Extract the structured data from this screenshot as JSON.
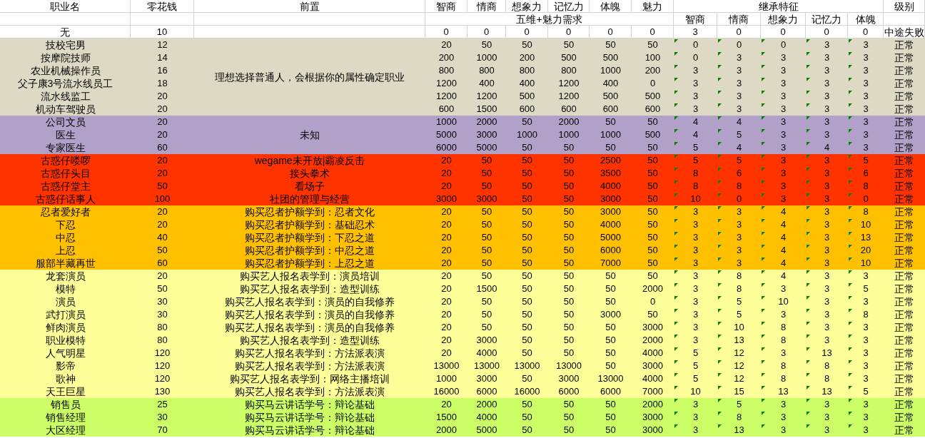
{
  "header": {
    "columns": [
      "职业名",
      "零花钱",
      "前置",
      "智商",
      "情商",
      "想象力",
      "记忆力",
      "体魄",
      "魅力"
    ],
    "inherit_title": "继承特征",
    "level_title": "级别"
  },
  "subheader": {
    "requirements_title": "五维+魅力需求",
    "inherit_columns": [
      "智商",
      "情商",
      "想象力",
      "记忆力",
      "体魄"
    ]
  },
  "base_row": {
    "name": "无",
    "money": "10",
    "requirements": [
      "0",
      "0",
      "0",
      "0",
      "0",
      "0"
    ],
    "inherit": [
      "3",
      "0",
      "0",
      "0",
      "0"
    ],
    "level": "中途失败"
  },
  "groups": [
    {
      "color": "#ddd9c4",
      "flagged": true,
      "prerequisite": "理想选择普通人，会根据你的属性确定职业",
      "rows": [
        {
          "name": "技校宅男",
          "money": "12",
          "requirements": [
            "20",
            "50",
            "50",
            "50",
            "50",
            "50"
          ],
          "inherit": [
            "0",
            "0",
            "0",
            "3",
            "3"
          ],
          "level": "正常"
        },
        {
          "name": "按摩院技师",
          "money": "14",
          "requirements": [
            "200",
            "1000",
            "200",
            "500",
            "500",
            "100"
          ],
          "inherit": [
            "0",
            "3",
            "3",
            "3",
            "3"
          ],
          "level": "正常"
        },
        {
          "name": "农业机械操作员",
          "money": "16",
          "requirements": [
            "800",
            "800",
            "800",
            "800",
            "1000",
            "200"
          ],
          "inherit": [
            "3",
            "3",
            "3",
            "3",
            "3"
          ],
          "level": "正常"
        },
        {
          "name": "父子康3号流水线员工",
          "money": "18",
          "requirements": [
            "1200",
            "400",
            "400",
            "1200",
            "400",
            "0"
          ],
          "inherit": [
            "3",
            "3",
            "3",
            "3",
            "3"
          ],
          "level": "正常"
        },
        {
          "name": "流水线监工",
          "money": "20",
          "requirements": [
            "1200",
            "1200",
            "500",
            "1200",
            "500",
            "500"
          ],
          "inherit": [
            "3",
            "3",
            "3",
            "3",
            "3"
          ],
          "level": "正常"
        },
        {
          "name": "机动车驾驶员",
          "money": "20",
          "requirements": [
            "600",
            "1500",
            "600",
            "600",
            "600",
            "600"
          ],
          "inherit": [
            "3",
            "3",
            "3",
            "3",
            "3"
          ],
          "level": "正常"
        }
      ]
    },
    {
      "color": "#b1a0c7",
      "flagged": true,
      "prerequisite": "未知",
      "rows": [
        {
          "name": "公司文员",
          "money": "20",
          "requirements": [
            "1000",
            "2000",
            "50",
            "2000",
            "50",
            "50"
          ],
          "inherit": [
            "4",
            "4",
            "3",
            "3",
            "3"
          ],
          "level": "正常"
        },
        {
          "name": "医生",
          "money": "20",
          "requirements": [
            "5000",
            "3000",
            "1000",
            "1000",
            "1000",
            "500"
          ],
          "inherit": [
            "4",
            "5",
            "3",
            "3",
            "3"
          ],
          "level": "正常"
        },
        {
          "name": "专家医生",
          "money": "60",
          "requirements": [
            "6000",
            "5000",
            "50",
            "50",
            "50",
            "50"
          ],
          "inherit": [
            "5",
            "4",
            "3",
            "4",
            "3"
          ],
          "level": "正常"
        }
      ]
    },
    {
      "color": "#ff3300",
      "flagged": true,
      "rows": [
        {
          "name": "古惑仔喽啰",
          "money": "20",
          "prerequisite": "wegame未开放|霸凌反击",
          "requirements": [
            "20",
            "50",
            "50",
            "50",
            "2500",
            "50"
          ],
          "inherit": [
            "5",
            "5",
            "3",
            "3",
            "5"
          ],
          "level": "正常"
        },
        {
          "name": "古惑仔头目",
          "money": "20",
          "prerequisite": "接头拳术",
          "requirements": [
            "20",
            "50",
            "50",
            "50",
            "3500",
            "50"
          ],
          "inherit": [
            "8",
            "6",
            "3",
            "3",
            "6"
          ],
          "level": "正常"
        },
        {
          "name": "古惑仔堂主",
          "money": "50",
          "prerequisite": "看场子",
          "requirements": [
            "20",
            "50",
            "50",
            "50",
            "4000",
            "50"
          ],
          "inherit": [
            "8",
            "8",
            "3",
            "3",
            "8"
          ],
          "level": "正常"
        },
        {
          "name": "古惑仔话事人",
          "money": "100",
          "prerequisite": "社团的管理与经营",
          "requirements": [
            "3000",
            "3000",
            "50",
            "50",
            "3000",
            "50"
          ],
          "inherit": [
            "10",
            "0",
            "3",
            "3",
            "0"
          ],
          "level": "正常"
        }
      ]
    },
    {
      "color": "#ffc000",
      "flagged": true,
      "rows": [
        {
          "name": "忍者爱好者",
          "money": "20",
          "prerequisite": "购买忍者护额学到：忍者文化",
          "requirements": [
            "20",
            "50",
            "50",
            "50",
            "3000",
            "50"
          ],
          "inherit": [
            "3",
            "3",
            "4",
            "3",
            "8"
          ],
          "level": "正常"
        },
        {
          "name": "下忍",
          "money": "20",
          "prerequisite": "购买忍者护额学到：基础忍术",
          "requirements": [
            "20",
            "50",
            "50",
            "50",
            "4000",
            "50"
          ],
          "inherit": [
            "3",
            "3",
            "4",
            "3",
            "10"
          ],
          "level": "正常"
        },
        {
          "name": "中忍",
          "money": "40",
          "prerequisite": "购买忍者护额学到：下忍之道",
          "requirements": [
            "20",
            "50",
            "50",
            "50",
            "5000",
            "50"
          ],
          "inherit": [
            "3",
            "3",
            "4",
            "3",
            "13"
          ],
          "level": "正常"
        },
        {
          "name": "上忍",
          "money": "50",
          "prerequisite": "购买忍者护额学到：中忍之道",
          "requirements": [
            "20",
            "50",
            "50",
            "50",
            "6000",
            "50"
          ],
          "inherit": [
            "3",
            "3",
            "4",
            "3",
            "20"
          ],
          "level": "正常"
        },
        {
          "name": "服部半藏再世",
          "money": "60",
          "prerequisite": "购买忍者护额学到：上忍之道",
          "requirements": [
            "20",
            "50",
            "50",
            "50",
            "7000",
            "50"
          ],
          "inherit": [
            "3",
            "3",
            "4",
            "3",
            "10"
          ],
          "level": "正常"
        }
      ]
    },
    {
      "color": "#ffff99",
      "flagged": true,
      "rows": [
        {
          "name": "龙套演员",
          "money": "20",
          "prerequisite": "购买艺人报名表学到：演员培训",
          "requirements": [
            "20",
            "50",
            "50",
            "50",
            "50",
            "50"
          ],
          "inherit": [
            "3",
            "8",
            "4",
            "3",
            "3"
          ],
          "level": "正常"
        },
        {
          "name": "模特",
          "money": "50",
          "prerequisite": "购买艺人报名表学到：造型训练",
          "requirements": [
            "20",
            "1500",
            "50",
            "50",
            "50",
            "2000"
          ],
          "inherit": [
            "3",
            "8",
            "3",
            "3",
            "5"
          ],
          "level": "正常"
        },
        {
          "name": "演员",
          "money": "30",
          "prerequisite": "购买艺人报名表学到：演员的自我修养",
          "requirements": [
            "20",
            "50",
            "50",
            "50",
            "50",
            "0"
          ],
          "inherit": [
            "3",
            "5",
            "10",
            "3",
            "3"
          ],
          "level": "正常"
        },
        {
          "name": "武打演员",
          "money": "30",
          "prerequisite": "购买艺人报名表学到：演员的自我修养",
          "requirements": [
            "20",
            "50",
            "50",
            "50",
            "3000",
            "50"
          ],
          "inherit": [
            "3",
            "5",
            "3",
            "3",
            "8"
          ],
          "level": "正常"
        },
        {
          "name": "鲜肉演员",
          "money": "80",
          "prerequisite": "购买艺人报名表学到：演员的自我修养",
          "requirements": [
            "20",
            "50",
            "50",
            "50",
            "50",
            "3000"
          ],
          "inherit": [
            "3",
            "10",
            "8",
            "3",
            "3"
          ],
          "level": "正常"
        },
        {
          "name": "职业模特",
          "money": "80",
          "prerequisite": "购买艺人报名表学到：造型训练",
          "requirements": [
            "20",
            "3000",
            "50",
            "50",
            "50",
            "2000"
          ],
          "inherit": [
            "3",
            "13",
            "8",
            "3",
            "3"
          ],
          "level": "正常"
        },
        {
          "name": "人气明星",
          "money": "120",
          "prerequisite": "购买艺人报名表学到：方法派表演",
          "requirements": [
            "20",
            "4000",
            "50",
            "50",
            "50",
            "4000"
          ],
          "inherit": [
            "5",
            "12",
            "3",
            "13",
            "3"
          ],
          "level": "正常"
        },
        {
          "name": "影帝",
          "money": "120",
          "prerequisite": "购买艺人报名表学到：方法派表演",
          "requirements": [
            "13000",
            "13000",
            "13000",
            "13000",
            "50",
            "3000"
          ],
          "inherit": [
            "5",
            "12",
            "8",
            "8",
            "3"
          ],
          "level": "正常"
        },
        {
          "name": "歌神",
          "money": "120",
          "prerequisite": "购买艺人报名表学到：网络主播培训",
          "requirements": [
            "1000",
            "3000",
            "50",
            "3000",
            "13000",
            "4000"
          ],
          "inherit": [
            "5",
            "12",
            "8",
            "8",
            "3"
          ],
          "level": "正常"
        },
        {
          "name": "天王巨星",
          "money": "130",
          "prerequisite": "购买艺人报名表学到：方法派表演",
          "requirements": [
            "16000",
            "6000",
            "16000",
            "6000",
            "6000",
            "7000"
          ],
          "inherit": [
            "10",
            "15",
            "13",
            "13",
            "5"
          ],
          "level": "正常"
        }
      ]
    },
    {
      "color": "#ccff66",
      "flagged": true,
      "rows": [
        {
          "name": "销售员",
          "money": "25",
          "prerequisite": "购买马云讲话学号：辩论基础",
          "requirements": [
            "20",
            "2000",
            "50",
            "50",
            "50",
            "2000"
          ],
          "inherit": [
            "3",
            "5",
            "3",
            "3",
            "3"
          ],
          "level": "正常"
        },
        {
          "name": "销售经理",
          "money": "30",
          "prerequisite": "购买马云讲话学号：辩论基础",
          "requirements": [
            "1500",
            "4000",
            "50",
            "50",
            "50",
            "3000"
          ],
          "inherit": [
            "3",
            "8",
            "3",
            "3",
            "3"
          ],
          "level": "正常"
        },
        {
          "name": "大区经理",
          "money": "70",
          "prerequisite": "购买马云讲话学号：辩论基础",
          "requirements": [
            "2000",
            "5000",
            "50",
            "50",
            "50",
            "3000"
          ],
          "inherit": [
            "3",
            "13",
            "3",
            "3",
            "3"
          ],
          "level": "正常"
        }
      ]
    }
  ]
}
